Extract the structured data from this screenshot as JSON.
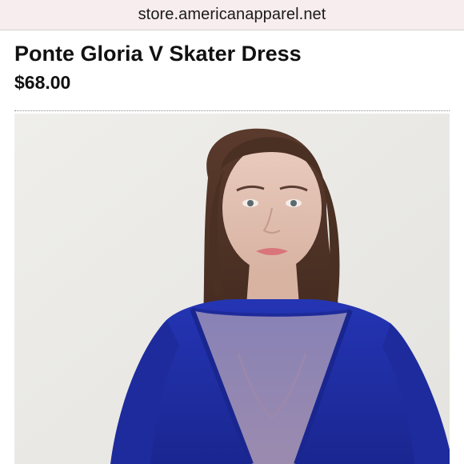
{
  "browser": {
    "url": "store.americanapparel.net"
  },
  "product": {
    "title": "Ponte Gloria V Skater Dress",
    "price": "$68.00"
  },
  "image": {
    "subject": "model-photo",
    "dress_color": "#1f2fa8",
    "mesh_color": "#8a84b8",
    "background_color": "#ecebe8"
  }
}
